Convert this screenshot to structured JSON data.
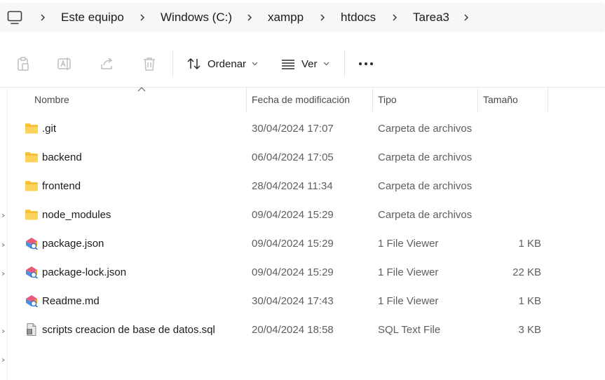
{
  "breadcrumb": {
    "items": [
      "Este equipo",
      "Windows (C:)",
      "xampp",
      "htdocs",
      "Tarea3"
    ]
  },
  "toolbar": {
    "sort_label": "Ordenar",
    "view_label": "Ver",
    "more_label": "•••"
  },
  "columns": {
    "name": "Nombre",
    "date": "Fecha de modificación",
    "type": "Tipo",
    "size": "Tamaño"
  },
  "files": [
    {
      "icon": "folder-icon",
      "name": ".git",
      "date": "30/04/2024 17:07",
      "type": "Carpeta de archivos",
      "size": ""
    },
    {
      "icon": "folder-icon",
      "name": "backend",
      "date": "06/04/2024 17:05",
      "type": "Carpeta de archivos",
      "size": ""
    },
    {
      "icon": "folder-icon",
      "name": "frontend",
      "date": "28/04/2024 11:34",
      "type": "Carpeta de archivos",
      "size": ""
    },
    {
      "icon": "folder-icon",
      "name": "node_modules",
      "date": "09/04/2024 15:29",
      "type": "Carpeta de archivos",
      "size": ""
    },
    {
      "icon": "file-viewer-icon",
      "name": "package.json",
      "date": "09/04/2024 15:29",
      "type": "1 File Viewer",
      "size": "1 KB"
    },
    {
      "icon": "file-viewer-icon",
      "name": "package-lock.json",
      "date": "09/04/2024 15:29",
      "type": "1 File Viewer",
      "size": "22 KB"
    },
    {
      "icon": "file-viewer-icon",
      "name": "Readme.md",
      "date": "30/04/2024 17:43",
      "type": "1 File Viewer",
      "size": "1 KB"
    },
    {
      "icon": "sql-file-icon",
      "name": "scripts creacion de base de datos.sql",
      "date": "20/04/2024 18:58",
      "type": "SQL Text File",
      "size": "3 KB"
    }
  ],
  "colors": {
    "folder": "#f8c53a",
    "folder_dark": "#e6a817",
    "accent": "#0067c0"
  }
}
